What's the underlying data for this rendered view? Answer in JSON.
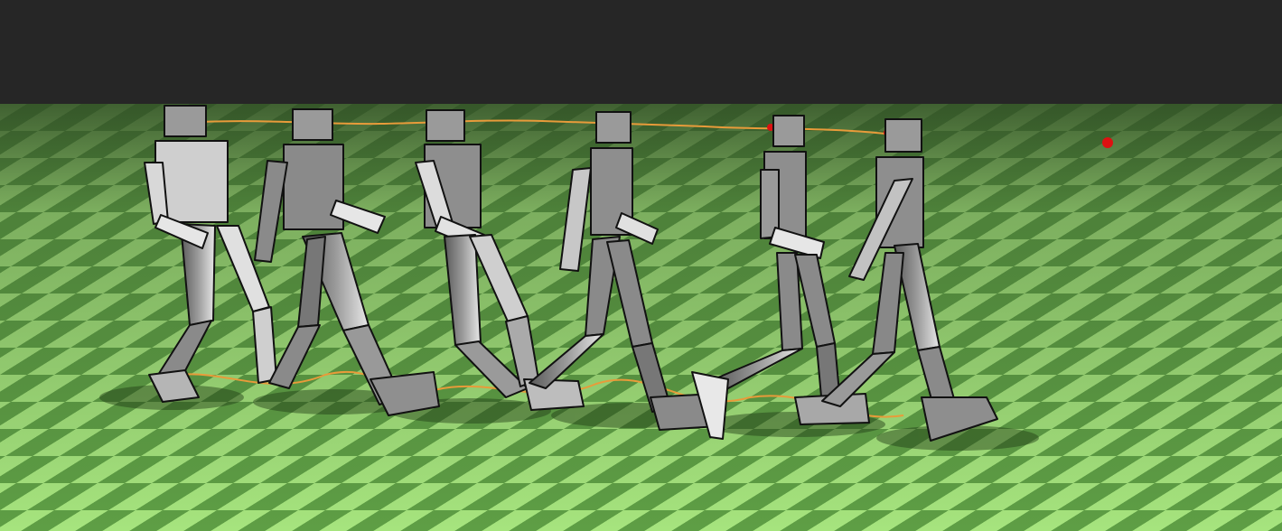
{
  "scene": {
    "description_colors": {
      "sky": "#262626",
      "floor_dark": "#4f8a3a",
      "floor_light": "#a9e880",
      "body_light": "#d9d9d9",
      "body_dark": "#707070",
      "trajectory": "#e89b3a",
      "target_marker": "#dd1111"
    },
    "figures_count": 6,
    "elements": [
      "ground-plane",
      "humanoid-figures",
      "head-trajectory",
      "foot-trajectory",
      "target-markers"
    ]
  }
}
